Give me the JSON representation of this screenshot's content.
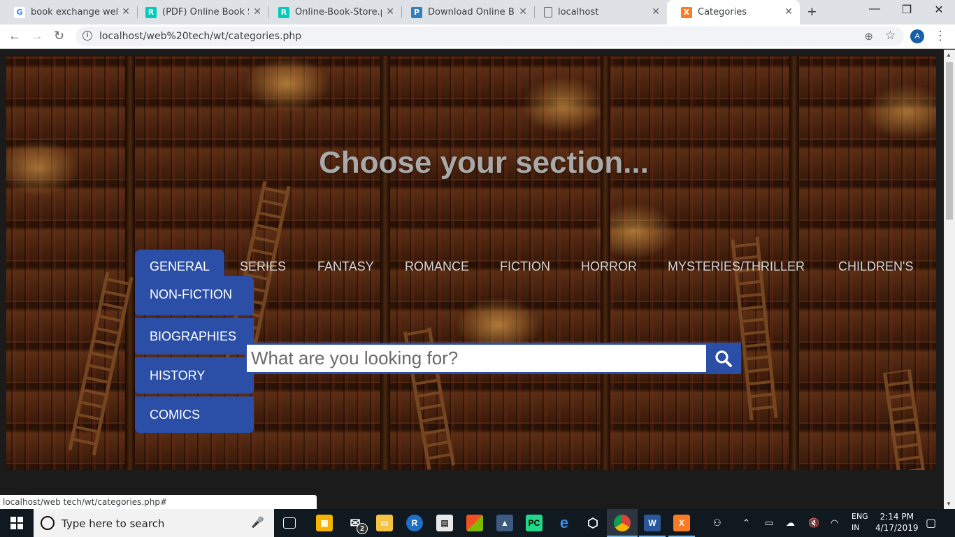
{
  "browser": {
    "tabs": [
      {
        "title": "book exchange website",
        "favicon": "google-icon",
        "color": "#ffffff",
        "glyph": "G"
      },
      {
        "title": "(PDF) Online Book Store",
        "favicon": "researchgate-icon",
        "color": "#00ccbb",
        "glyph": "R"
      },
      {
        "title": "Online-Book-Store.pdf",
        "favicon": "researchgate-icon",
        "color": "#00ccbb",
        "glyph": "R"
      },
      {
        "title": "Download Online Book",
        "favicon": "pyrsin-icon",
        "color": "#2f7fbf",
        "glyph": "P"
      },
      {
        "title": "localhost",
        "favicon": "page-icon",
        "color": "#dee1e6",
        "glyph": ""
      },
      {
        "title": "Categories",
        "favicon": "xampp-icon",
        "color": "#fb7a24",
        "glyph": "X"
      }
    ],
    "url": "localhost/web%20tech/wt/categories.php",
    "profile_initial": "A",
    "status_url": "localhost/web tech/wt/categories.php#"
  },
  "page": {
    "headline": "Choose your section...",
    "categories": [
      "GENERAL",
      "SERIES",
      "FANTASY",
      "ROMANCE",
      "FICTION",
      "HORROR",
      "MYSTERIES/THRILLER",
      "CHILDREN'S"
    ],
    "dropdown_items": [
      "NON-FICTION",
      "BIOGRAPHIES",
      "HISTORY",
      "COMICS"
    ],
    "search_placeholder": "What are you looking for?",
    "accent_color": "#2b4fa7"
  },
  "taskbar": {
    "search_placeholder": "Type here to search",
    "mail_badge": "2",
    "language": "ENG",
    "region": "IN",
    "time": "2:14 PM",
    "date": "4/17/2019"
  }
}
